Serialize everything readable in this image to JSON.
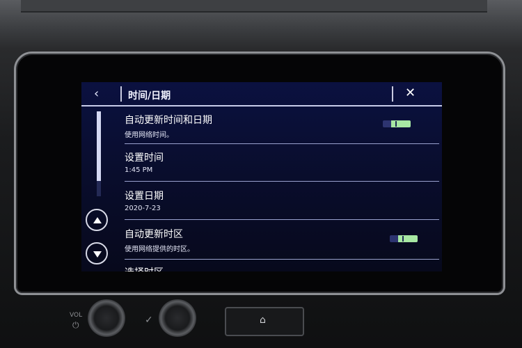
{
  "header": {
    "back_icon": "‹",
    "title": "时间/日期",
    "close_icon": "✕"
  },
  "settings": [
    {
      "label": "自动更新时间和日期",
      "value": "使用网络时间。",
      "toggle": true,
      "toggle_state": "on"
    },
    {
      "label": "设置时间",
      "value": "1:45 PM"
    },
    {
      "label": "设置日期",
      "value": "2020-7-23"
    },
    {
      "label": "自动更新时区",
      "value": "使用网络提供的时区。",
      "toggle": true,
      "toggle_state": "on"
    },
    {
      "label": "选择时区",
      "value": ""
    }
  ],
  "scroll": {
    "up_icon": "chevron-up-icon",
    "down_icon": "chevron-down-icon"
  },
  "hardware": {
    "vol_label": "VOL",
    "power_icon": "⏻",
    "check_icon": "✓",
    "home_icon": "⌂"
  },
  "colors": {
    "screen_bg": "#0b1140",
    "toggle_on": "#a7e7a3",
    "divider": "#9aa2cf"
  }
}
